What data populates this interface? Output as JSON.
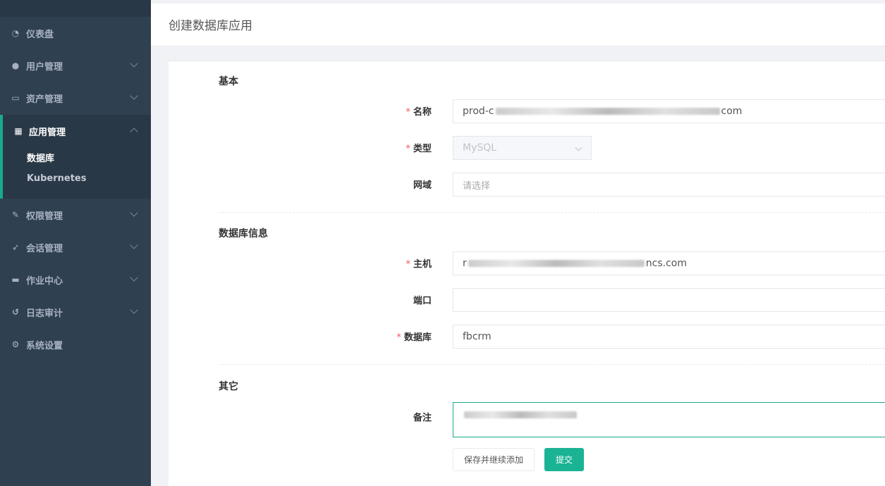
{
  "sidebar": {
    "items": [
      {
        "label": "仪表盘",
        "icon": "dashboard-icon"
      },
      {
        "label": "用户管理",
        "icon": "users-icon"
      },
      {
        "label": "资产管理",
        "icon": "inbox-icon"
      },
      {
        "label": "应用管理",
        "icon": "grid-icon"
      },
      {
        "label": "权限管理",
        "icon": "edit-icon"
      },
      {
        "label": "会话管理",
        "icon": "rocket-icon"
      },
      {
        "label": "作业中心",
        "icon": "terminal-icon"
      },
      {
        "label": "日志审计",
        "icon": "history-icon"
      },
      {
        "label": "系统设置",
        "icon": "gears-icon"
      }
    ],
    "submenu": [
      {
        "label": "数据库"
      },
      {
        "label": "Kubernetes"
      }
    ]
  },
  "page": {
    "title": "创建数据库应用"
  },
  "form": {
    "sections": {
      "basic": "基本",
      "db_info": "数据库信息",
      "other": "其它"
    },
    "required_mark": "*",
    "name_label": "名称",
    "name_prefix": "prod-c",
    "name_suffix": "com",
    "type_label": "类型",
    "type_value": "MySQL",
    "domain_label": "网域",
    "domain_placeholder": "请选择",
    "host_label": "主机",
    "host_prefix": "r",
    "host_suffix": "ncs.com",
    "port_label": "端口",
    "port_value": "",
    "database_label": "数据库",
    "database_value": "fbcrm",
    "comment_label": "备注",
    "save_continue_label": "保存并继续添加",
    "submit_label": "提交"
  },
  "colors": {
    "sidebar_bg": "#2f4050",
    "accent": "#1ab394",
    "required": "#ed5565"
  }
}
